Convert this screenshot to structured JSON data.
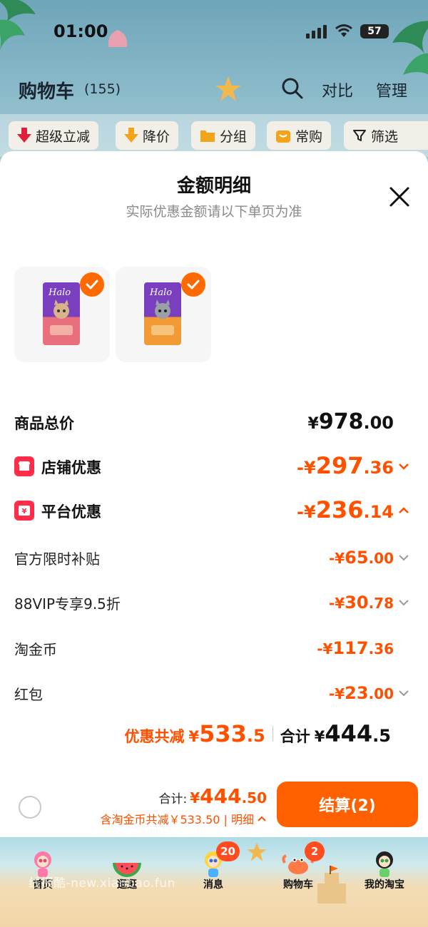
{
  "status_bar": {
    "time": "01:00",
    "battery": "57"
  },
  "header": {
    "title": "购物车",
    "count": "(155)",
    "compare": "对比",
    "manage": "管理"
  },
  "filters": [
    {
      "label": "超级立减",
      "icon": "down-arrow-icon"
    },
    {
      "label": "降价",
      "icon": "price-drop-icon"
    },
    {
      "label": "分组",
      "icon": "folder-icon"
    },
    {
      "label": "常购",
      "icon": "bag-icon"
    },
    {
      "label": "筛选",
      "icon": "filter-icon"
    }
  ],
  "sheet": {
    "title": "金额明细",
    "subtitle": "实际优惠金额请以下单页为准",
    "products": [
      {
        "name": "Halo holistic cat food pink",
        "color": "#e86f7d"
      },
      {
        "name": "Halo holistic cat food orange",
        "color": "#f29a36"
      }
    ],
    "rows": {
      "total": {
        "label": "商品总价",
        "currency": "¥",
        "int": "978",
        "dec": ".00"
      },
      "store": {
        "label": "店铺优惠",
        "prefix": "-¥",
        "int": "297",
        "dec": ".36"
      },
      "platform": {
        "label": "平台优惠",
        "prefix": "-¥",
        "int": "236",
        "dec": ".14"
      },
      "subsidy": {
        "label": "官方限时补贴",
        "prefix": "-¥",
        "int": "65",
        "dec": ".00"
      },
      "vip": {
        "label": "88VIP专享9.5折",
        "prefix": "-¥",
        "int": "30",
        "dec": ".78"
      },
      "coins": {
        "label": "淘金币",
        "prefix": "-¥",
        "int": "117",
        "dec": ".36"
      },
      "redpacket": {
        "label": "红包",
        "prefix": "-¥",
        "int": "23",
        "dec": ".00"
      }
    },
    "summary": {
      "discount_label": "优惠共减",
      "discount_currency": "¥",
      "discount_int": "533",
      "discount_dec": ".5",
      "total_label": "合计",
      "total_currency": "¥",
      "total_int": "444",
      "total_dec": ".5"
    },
    "checkout": {
      "total_label": "合计:",
      "total_currency": "¥",
      "total_int": "444",
      "total_dec": ".50",
      "detail_text": "含淘金币共减￥533.50 | 明细",
      "button": "结算(2)"
    }
  },
  "tabbar": [
    {
      "label": "首页"
    },
    {
      "label": "逛逛"
    },
    {
      "label": "消息",
      "badge": "20"
    },
    {
      "label": "购物车",
      "badge": "2"
    },
    {
      "label": "我的淘宝"
    }
  ],
  "watermark": "线报酷-new.xianbao.fun",
  "colors": {
    "accent": "#ff5000",
    "button": "#ff6000",
    "badge_red": "#ff2d4a"
  }
}
